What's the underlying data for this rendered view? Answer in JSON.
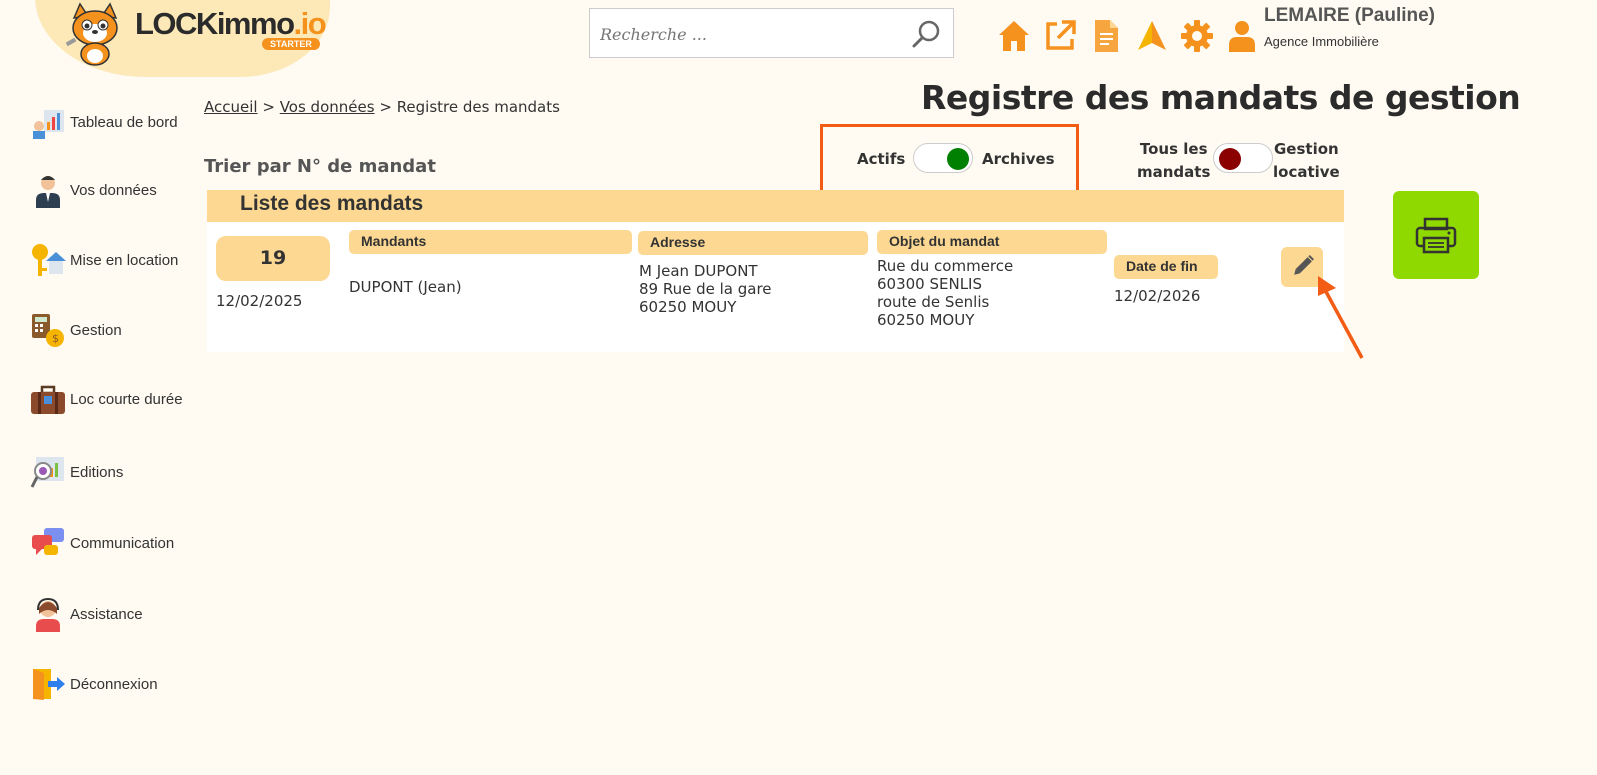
{
  "logo": {
    "name_main": "LOCKimmo",
    "name_suffix": ".io",
    "badge": "STARTER"
  },
  "search": {
    "placeholder": "Recherche ..."
  },
  "top_icons": [
    "home-icon",
    "external-link-icon",
    "document-icon",
    "paper-plane-icon",
    "gear-icon",
    "user-icon"
  ],
  "user": {
    "name": "LEMAIRE (Pauline)",
    "agency": "Agence Immobilière"
  },
  "sidebar": {
    "items": [
      {
        "label": "Tableau de bord",
        "icon": "dashboard-icon"
      },
      {
        "label": "Vos données",
        "icon": "person-icon"
      },
      {
        "label": "Mise en location",
        "icon": "keys-house-icon"
      },
      {
        "label": "Gestion",
        "icon": "calculator-icon"
      },
      {
        "label": "Loc courte durée",
        "icon": "suitcase-icon"
      },
      {
        "label": "Editions",
        "icon": "chart-magnifier-icon"
      },
      {
        "label": "Communication",
        "icon": "chat-bubbles-icon"
      },
      {
        "label": "Assistance",
        "icon": "support-agent-icon"
      },
      {
        "label": "Déconnexion",
        "icon": "logout-door-icon"
      }
    ]
  },
  "breadcrumb": {
    "home": "Accueil",
    "sep1": ">",
    "data": "Vos données",
    "sep2": ">",
    "current": "Registre des mandats"
  },
  "page_title": "Registre des mandats de gestion",
  "sort_label": "Trier par N° de mandat",
  "toggle_status": {
    "left": "Actifs",
    "right": "Archives",
    "knob_color": "#008000"
  },
  "toggle_type": {
    "left_line1": "Tous les",
    "left_line2": "mandats",
    "right_line1": "Gestion",
    "right_line2": "locative",
    "knob_color": "#8b0000"
  },
  "list": {
    "title": "Liste des mandats",
    "columns": {
      "mandants": "Mandants",
      "adresse": "Adresse",
      "objet": "Objet du mandat",
      "date_fin": "Date de fin"
    },
    "rows": [
      {
        "number": "19",
        "date": "12/02/2025",
        "mandants": "DUPONT (Jean)",
        "adresse": [
          "M Jean DUPONT",
          "89 Rue de la gare",
          "60250 MOUY"
        ],
        "objet": [
          "Rue du commerce",
          "60300 SENLIS",
          "route de Senlis",
          "60250 MOUY"
        ],
        "date_fin": "12/02/2026"
      }
    ]
  },
  "colors": {
    "accent": "#f5921e",
    "header_bg": "#fcd892",
    "highlight": "#f25c15",
    "print_bg": "#8fd800"
  }
}
